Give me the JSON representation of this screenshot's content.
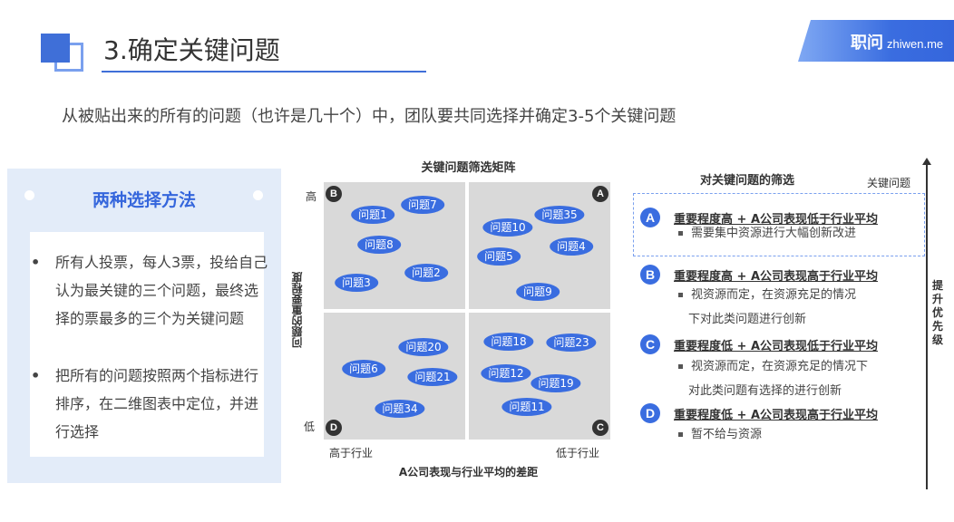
{
  "header": {
    "title": "3.确定关键问题",
    "brand_cn": "职问",
    "brand_en": "zhiwen.me"
  },
  "subtitle": "从被贴出来的所有的问题（也许是几十个）中，团队要共同选择并确定3-5个关键问题",
  "left_panel": {
    "title": "两种选择方法",
    "bullets": [
      "所有人投票，每人3票，投给自己认为最关键的三个问题，最终选择的票最多的三个为关键问题",
      "把所有的问题按照两个指标进行排序，在二维图表中定位，并进行选择"
    ]
  },
  "matrix": {
    "title": "关键问题筛选矩阵",
    "y_title": "问题的重要程度",
    "y_high": "高",
    "y_low": "低",
    "x_title": "A公司表现与行业平均的差距",
    "x_left": "高于行业",
    "x_right": "低于行业",
    "corners": {
      "b": "B",
      "a": "A",
      "d": "D",
      "c": "C"
    },
    "bubbles": [
      {
        "label": "问题1"
      },
      {
        "label": "问题7"
      },
      {
        "label": "问题8"
      },
      {
        "label": "问题2"
      },
      {
        "label": "问题3"
      },
      {
        "label": "问题10"
      },
      {
        "label": "问题35"
      },
      {
        "label": "问题5"
      },
      {
        "label": "问题4"
      },
      {
        "label": "问题9"
      },
      {
        "label": "问题20"
      },
      {
        "label": "问题6"
      },
      {
        "label": "问题21"
      },
      {
        "label": "问题34"
      },
      {
        "label": "问题18"
      },
      {
        "label": "问题23"
      },
      {
        "label": "问题12"
      },
      {
        "label": "问题19"
      },
      {
        "label": "问题11"
      }
    ]
  },
  "screening": {
    "title": "对关键问题的筛选",
    "key_label": "关键问题",
    "priority_label": "提升优先级",
    "items": [
      {
        "badge": "A",
        "head": "重要程度高 + A公司表现低于行业平均",
        "desc": [
          "需要集中资源进行大幅创新改进"
        ]
      },
      {
        "badge": "B",
        "head": "重要程度高 + A公司表现高于行业平均",
        "desc": [
          "视资源而定，在资源充足的情况",
          "下对此类问题进行创新"
        ]
      },
      {
        "badge": "C",
        "head": "重要程度低 + A公司表现低于行业平均",
        "desc": [
          "视资源而定，在资源充足的情况下",
          "对此类问题有选择的进行创新"
        ]
      },
      {
        "badge": "D",
        "head": "重要程度低 + A公司表现高于行业平均",
        "desc": [
          "暂不给与资源"
        ]
      }
    ]
  }
}
